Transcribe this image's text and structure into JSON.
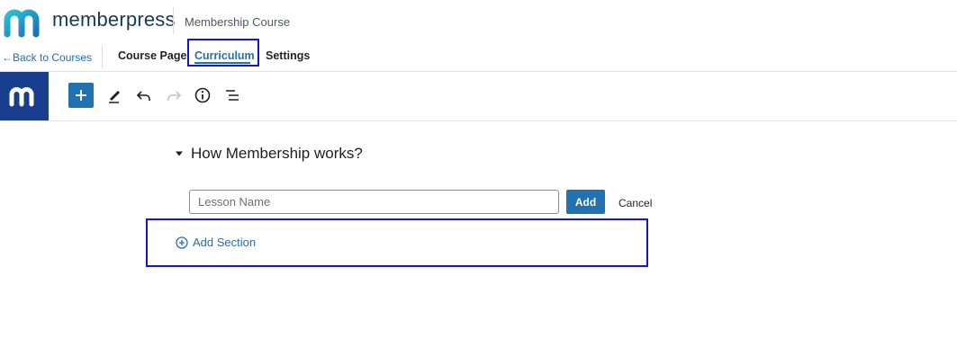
{
  "brand": {
    "name": "memberpress",
    "page_name": "Membership Course"
  },
  "nav": {
    "back_label": "←Back to Courses",
    "tabs": [
      {
        "label": "Course Page",
        "active": false
      },
      {
        "label": "Curriculum",
        "active": true
      },
      {
        "label": "Settings",
        "active": false
      }
    ]
  },
  "toolbar": {
    "icons": [
      "memberpress-logo-icon",
      "plus-icon",
      "pencil-icon",
      "undo-icon",
      "redo-icon",
      "info-icon",
      "list-view-icon"
    ]
  },
  "curriculum": {
    "section_title": "How Membership works?",
    "lesson_input": {
      "value": "",
      "placeholder": "Lesson Name"
    },
    "add_label": "Add",
    "cancel_label": "Cancel",
    "add_section_label": "Add Section"
  },
  "colors": {
    "accent": "#2271b1",
    "logo_bg": "#1a3e8e",
    "highlight": "#1414d6"
  }
}
